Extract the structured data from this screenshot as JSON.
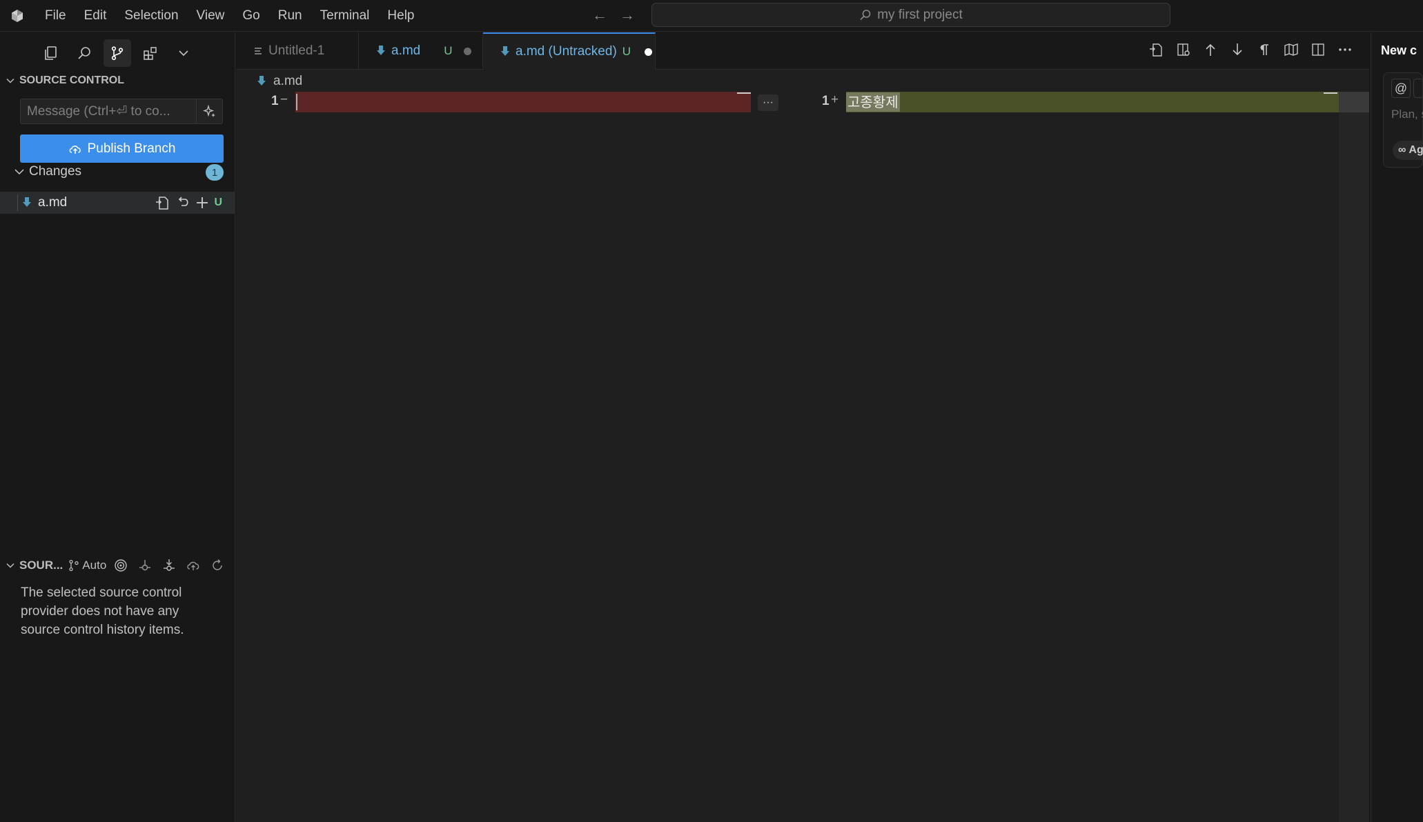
{
  "menu": [
    "File",
    "Edit",
    "Selection",
    "View",
    "Go",
    "Run",
    "Terminal",
    "Help"
  ],
  "command_center": {
    "text": "my first project",
    "icon": "search-icon"
  },
  "sidebar": {
    "activity": [
      "explorer-icon",
      "search-icon",
      "source-control-icon",
      "extensions-icon",
      "chevron-down-icon"
    ],
    "source_control": {
      "title": "SOURCE CONTROL",
      "message_placeholder": "Message (Ctrl+⏎ to co...",
      "publish_label": "Publish Branch",
      "changes_label": "Changes",
      "changes_count": "1",
      "file": {
        "name": "a.md",
        "status": "U"
      }
    },
    "history": {
      "title": "SOUR...",
      "branch_label": "Auto",
      "empty_message": "The selected source control provider does not have any source control history items."
    }
  },
  "tabs": [
    {
      "label": "Untitled-1",
      "status": ""
    },
    {
      "label": "a.md",
      "status": "U"
    },
    {
      "label": "a.md (Untracked)",
      "status": "U"
    }
  ],
  "breadcrumb": "a.md",
  "diff": {
    "left": {
      "line_number": "1",
      "marker": "−",
      "text": ""
    },
    "right": {
      "line_number": "1",
      "marker": "+",
      "text": "고종황제"
    },
    "more_label": "···"
  },
  "chat": {
    "title": "New c",
    "at_label": "@",
    "placeholder": "Plan, s",
    "mode_label": "Ag",
    "mode_icon": "∞"
  },
  "colors": {
    "accent": "#3b8eea",
    "removed": "#5b2625",
    "added": "#4a5128",
    "untracked": "#73c991",
    "markdown_icon": "#519aba"
  }
}
